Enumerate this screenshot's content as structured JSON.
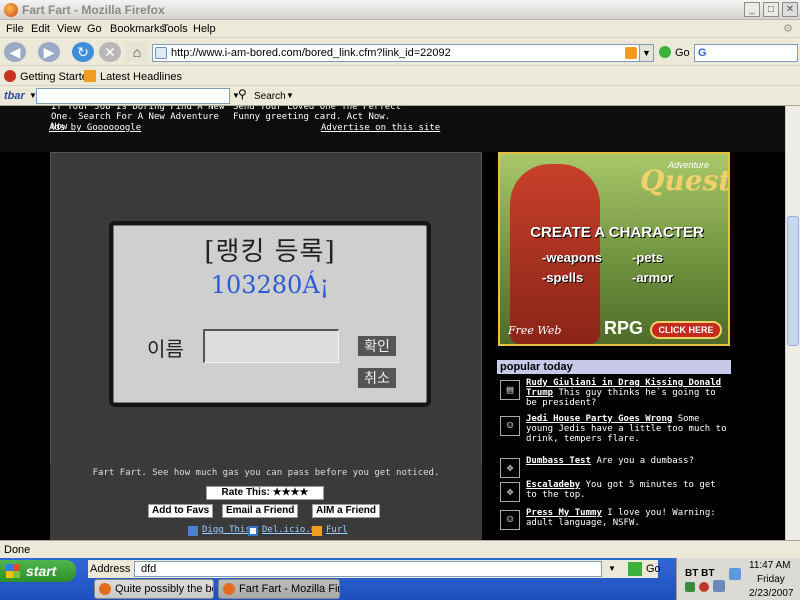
{
  "window": {
    "title": "Fart Fart - Mozilla Firefox",
    "min": "_",
    "max": "□",
    "close": "✕"
  },
  "menu": [
    "File",
    "Edit",
    "View",
    "Go",
    "Bookmarks",
    "Tools",
    "Help"
  ],
  "nav": {
    "url": "http://www.i-am-bored.com/bored_link.cfm?link_id=22092",
    "go_label": "Go"
  },
  "bookmarks": [
    "Getting Started",
    "Latest Headlines"
  ],
  "tbar": {
    "logo": "tbar",
    "search_label": "Search"
  },
  "ads": {
    "left_text": "If Your Job Is Boring Find A New One. Search For A New Adventure Now",
    "right_text": "Send Your Loved One The Perfect Funny greeting card. Act Now.",
    "ads_by": "Ads by Goooooogle",
    "advertise": "Advertise on this site"
  },
  "game": {
    "heading": "[랭킹 등록]",
    "score": "103280Á¡",
    "name_label": "이름",
    "confirm": "확인",
    "cancel": "취소"
  },
  "caption": "Fart Fart. See how much gas you can pass before you get noticed.",
  "actions": {
    "rate": "Rate This: ★★★★",
    "add_favs": "Add to Favs",
    "email": "Email a Friend",
    "aim": "AIM a Friend",
    "digg": "Digg This",
    "delicious": "Del.icio.us",
    "furl": "Furl"
  },
  "banner": {
    "brand_small": "Adventure",
    "brand": "Quest",
    "line1": "CREATE A CHARACTER",
    "opts": [
      "-weapons",
      "-pets",
      "-spells",
      "-armor"
    ],
    "free": "Free Web",
    "rpg": "RPG",
    "click": "CLICK HERE"
  },
  "popular": {
    "header": "popular today",
    "items": [
      {
        "title": "Rudy Giuliani in Drag Kissing Donald Trump",
        "desc": "This guy thinks he`s going to be president?"
      },
      {
        "title": "Jedi House Party Goes Wrong",
        "desc": "Some young Jedis have a little too much to drink, tempers flare."
      },
      {
        "title": "Dumbass Test",
        "desc": "Are you a dumbass?"
      },
      {
        "title": "Escaladeby",
        "desc": "You got 5 minutes to get to the top."
      },
      {
        "title": "Press My Tummy",
        "desc": "I love you! Warning: adult language, NSFW."
      }
    ]
  },
  "status": "Done",
  "taskbar": {
    "start": "start",
    "address_label": "Address",
    "address_value": "dfd",
    "go": "Go",
    "tasks": [
      "Quite possibly the be...",
      "Fart Fart - Mozilla Fir..."
    ],
    "tray_text": "BT BT",
    "time": "11:47 AM",
    "day": "Friday",
    "date": "2/23/2007"
  }
}
